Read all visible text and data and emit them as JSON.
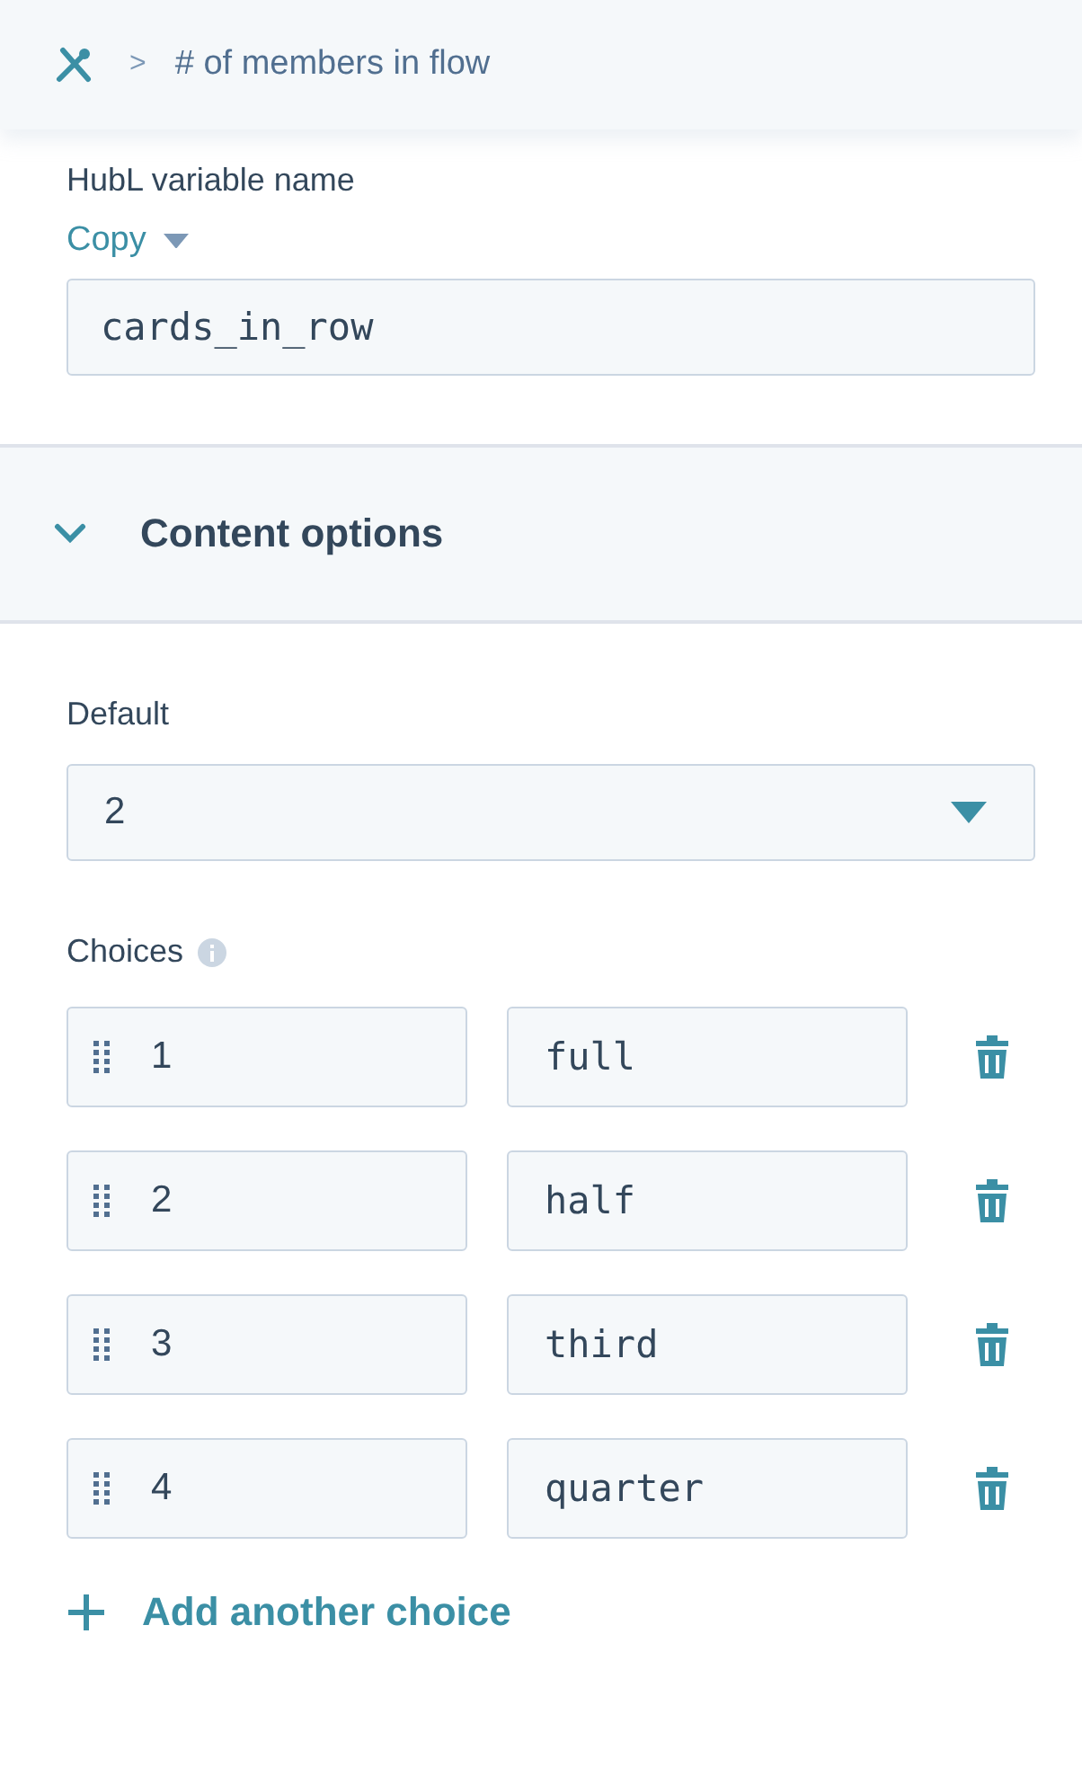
{
  "breadcrumb": {
    "separator": ">",
    "current": "# of members in flow"
  },
  "hubl": {
    "label": "HubL variable name",
    "copy": "Copy",
    "value": "cards_in_row"
  },
  "section": {
    "title": "Content options",
    "expanded": true
  },
  "default": {
    "label": "Default",
    "value": "2"
  },
  "choices": {
    "label": "Choices",
    "items": [
      {
        "value": "1",
        "label": "full"
      },
      {
        "value": "2",
        "label": "half"
      },
      {
        "value": "3",
        "label": "third"
      },
      {
        "value": "4",
        "label": "quarter"
      }
    ],
    "add": "Add another choice"
  }
}
